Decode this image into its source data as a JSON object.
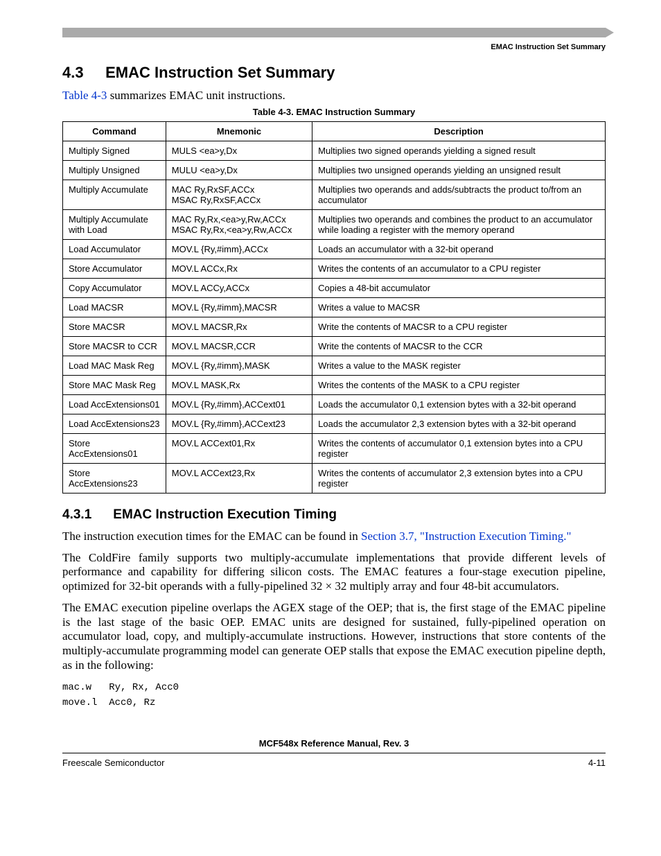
{
  "header": {
    "running_head": "EMAC Instruction Set Summary"
  },
  "section": {
    "number": "4.3",
    "title": "EMAC Instruction Set Summary",
    "intro_prefix": "Table 4-3",
    "intro_rest": " summarizes EMAC unit instructions."
  },
  "table": {
    "caption": "Table 4-3. EMAC Instruction Summary",
    "headers": [
      "Command",
      "Mnemonic",
      "Description"
    ],
    "rows": [
      [
        "Multiply Signed",
        "MULS <ea>y,Dx",
        "Multiplies two signed operands yielding a signed result"
      ],
      [
        "Multiply Unsigned",
        "MULU <ea>y,Dx",
        "Multiplies two unsigned operands yielding an unsigned result"
      ],
      [
        "Multiply Accumulate",
        "MAC Ry,RxSF,ACCx\nMSAC Ry,RxSF,ACCx",
        "Multiplies two operands and adds/subtracts the product to/from an accumulator"
      ],
      [
        "Multiply Accumulate with Load",
        "MAC Ry,Rx,<ea>y,Rw,ACCx\nMSAC Ry,Rx,<ea>y,Rw,ACCx",
        "Multiplies two operands and combines the product to an accumulator while loading a register with the memory operand"
      ],
      [
        "Load Accumulator",
        "MOV.L {Ry,#imm},ACCx",
        "Loads an accumulator with a 32-bit operand"
      ],
      [
        "Store Accumulator",
        "MOV.L ACCx,Rx",
        "Writes the contents of an accumulator to a CPU register"
      ],
      [
        "Copy Accumulator",
        "MOV.L ACCy,ACCx",
        "Copies a 48-bit accumulator"
      ],
      [
        "Load MACSR",
        "MOV.L {Ry,#imm},MACSR",
        "Writes a value to MACSR"
      ],
      [
        "Store MACSR",
        "MOV.L MACSR,Rx",
        "Write the contents of MACSR to a CPU register"
      ],
      [
        "Store MACSR to CCR",
        "MOV.L MACSR,CCR",
        "Write the contents of MACSR to the CCR"
      ],
      [
        "Load MAC Mask Reg",
        "MOV.L {Ry,#imm},MASK",
        "Writes a value to the MASK register"
      ],
      [
        "Store MAC Mask Reg",
        "MOV.L MASK,Rx",
        "Writes the contents of the MASK to a CPU register"
      ],
      [
        "Load AccExtensions01",
        "MOV.L {Ry,#imm},ACCext01",
        "Loads the accumulator 0,1 extension bytes with a 32-bit operand"
      ],
      [
        "Load AccExtensions23",
        "MOV.L {Ry,#imm},ACCext23",
        "Loads the accumulator 2,3 extension bytes with a 32-bit operand"
      ],
      [
        "Store AccExtensions01",
        "MOV.L ACCext01,Rx",
        "Writes the contents of accumulator 0,1 extension bytes into a CPU register"
      ],
      [
        "Store AccExtensions23",
        "MOV.L ACCext23,Rx",
        "Writes the contents of accumulator 2,3 extension bytes into a CPU register"
      ]
    ]
  },
  "subsection": {
    "number": "4.3.1",
    "title": "EMAC Instruction Execution Timing",
    "para1_prefix": "The instruction execution times for the EMAC can be found in ",
    "para1_link": "Section 3.7, \"Instruction Execution Timing.\"",
    "para2": "The ColdFire family supports two multiply-accumulate implementations that provide different levels of performance and capability for differing silicon costs. The EMAC features a four-stage execution pipeline, optimized for 32-bit operands with a fully-pipelined 32 × 32 multiply array and four 48-bit accumulators.",
    "para3": "The EMAC execution pipeline overlaps the AGEX stage of the OEP; that is, the first stage of the EMAC pipeline is the last stage of the basic OEP. EMAC units are designed for sustained, fully-pipelined operation on accumulator load, copy, and multiply-accumulate instructions. However, instructions that store contents of the multiply-accumulate programming model can generate OEP stalls that expose the EMAC execution pipeline depth, as in the following:",
    "code": "mac.w   Ry, Rx, Acc0\nmove.l  Acc0, Rz"
  },
  "footer": {
    "manual": "MCF548x Reference Manual, Rev. 3",
    "left": "Freescale Semiconductor",
    "right": "4-11"
  }
}
